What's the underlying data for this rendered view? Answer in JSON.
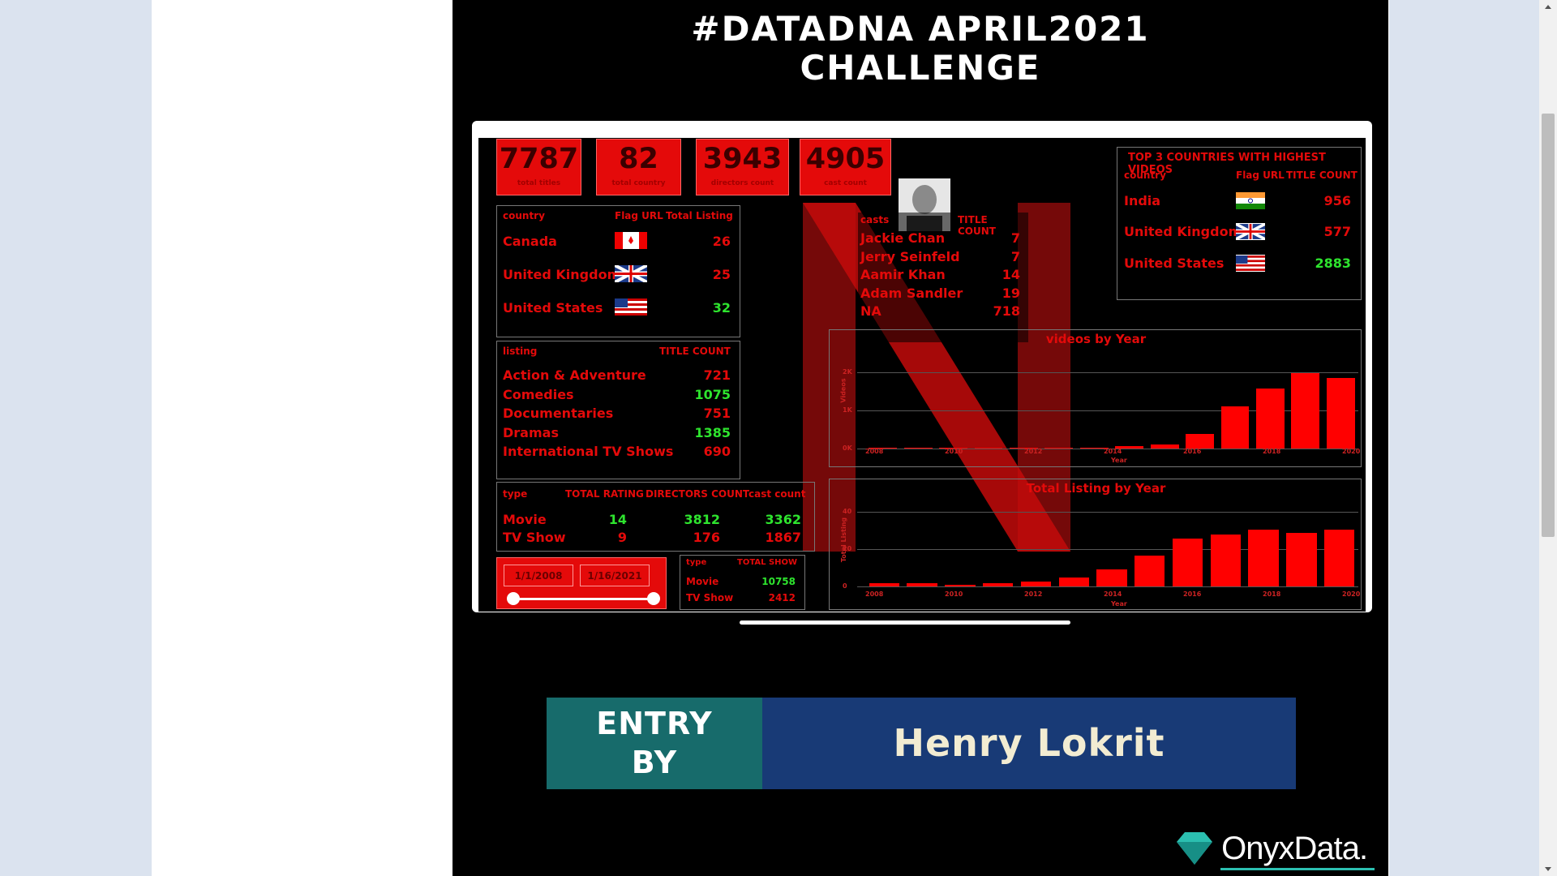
{
  "poster": {
    "title_line1": "#DATADNA APRIL2021",
    "title_line2": "CHALLENGE",
    "entry_label_line1": "ENTRY",
    "entry_label_line2": "BY",
    "entrant": "Henry Lokrit",
    "logo_text": "OnyxData."
  },
  "colors": {
    "red": "#e40a0a",
    "green": "#2ee42e",
    "teal": "#176b6b",
    "navy": "#183a76"
  },
  "kpis": [
    {
      "value": "7787",
      "label": "total titles"
    },
    {
      "value": "82",
      "label": "total country"
    },
    {
      "value": "3943",
      "label": "directors count"
    },
    {
      "value": "4905",
      "label": "cast count"
    }
  ],
  "country_table": {
    "headers": [
      "country",
      "Flag URL",
      "Total Listing"
    ],
    "rows": [
      {
        "country": "Canada",
        "value": "26",
        "flag": "canada-flag-icon"
      },
      {
        "country": "United Kingdom",
        "value": "25",
        "flag": "uk-flag-icon"
      },
      {
        "country": "United States",
        "value": "32",
        "flag": "us-flag-icon"
      }
    ]
  },
  "cast_table": {
    "headers": [
      "casts",
      "TITLE COUNT"
    ],
    "rows": [
      {
        "name": "Jackie Chan",
        "value": "7"
      },
      {
        "name": "Jerry Seinfeld",
        "value": "7"
      },
      {
        "name": "Aamir Khan",
        "value": "14"
      },
      {
        "name": "Adam Sandler",
        "value": "19"
      },
      {
        "name": "NA",
        "value": "718"
      }
    ]
  },
  "top3_table": {
    "title": "TOP 3 COUNTRIES WITH HIGHEST VIDEOS",
    "headers": [
      "country",
      "Flag URL",
      "TITLE COUNT"
    ],
    "rows": [
      {
        "country": "India",
        "value": "956",
        "flag": "india-flag-icon"
      },
      {
        "country": "United Kingdom",
        "value": "577",
        "flag": "uk-flag-icon"
      },
      {
        "country": "United States",
        "value": "2883",
        "flag": "us-flag-icon"
      }
    ]
  },
  "listing_table": {
    "headers": [
      "listing",
      "TITLE COUNT"
    ],
    "rows": [
      {
        "name": "Action & Adventure",
        "value": "721"
      },
      {
        "name": "Comedies",
        "value": "1075"
      },
      {
        "name": "Documentaries",
        "value": "751"
      },
      {
        "name": "Dramas",
        "value": "1385"
      },
      {
        "name": "International TV Shows",
        "value": "690"
      }
    ]
  },
  "type_table": {
    "headers": [
      "type",
      "TOTAL RATING",
      "DIRECTORS COUNT",
      "cast count"
    ],
    "rows": [
      {
        "type": "Movie",
        "rating": "14",
        "directors": "3812",
        "cast": "3362"
      },
      {
        "type": "TV Show",
        "rating": "9",
        "directors": "176",
        "cast": "1867"
      }
    ]
  },
  "date_filter": {
    "start": "1/1/2008",
    "end": "1/16/2021"
  },
  "show_table": {
    "headers": [
      "type",
      "TOTAL SHOW"
    ],
    "rows": [
      {
        "type": "Movie",
        "value": "10758"
      },
      {
        "type": "TV Show",
        "value": "2412"
      }
    ]
  },
  "chart_data": [
    {
      "type": "bar",
      "title": "videos by Year",
      "xlabel": "Year",
      "ylabel": "Videos",
      "tick_labels_x": [
        "2008",
        "2010",
        "2012",
        "2014",
        "2016",
        "2018",
        "2020"
      ],
      "tick_labels_y": [
        "0K",
        "1K",
        "2K"
      ],
      "ylim": [
        0,
        2400
      ],
      "values": [
        0,
        0,
        5,
        10,
        15,
        20,
        30,
        60,
        110,
        420,
        1200,
        1700,
        2150,
        2000
      ]
    },
    {
      "type": "bar",
      "title": "Total Listing by Year",
      "xlabel": "Year",
      "ylabel": "Total Listing",
      "tick_labels_x": [
        "2008",
        "2010",
        "2012",
        "2014",
        "2016",
        "2018",
        "2020"
      ],
      "tick_labels_y": [
        "0",
        "20",
        "40"
      ],
      "ylim": [
        0,
        48
      ],
      "values": [
        2,
        2,
        1,
        2,
        3,
        5,
        10,
        18,
        28,
        30,
        33,
        31,
        33
      ]
    }
  ]
}
